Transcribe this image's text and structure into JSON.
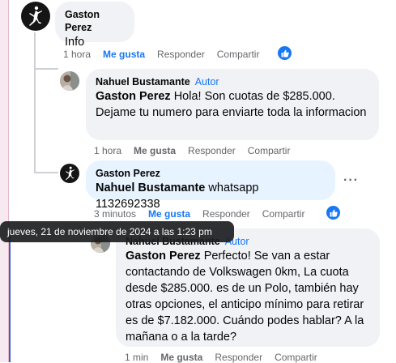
{
  "comments": [
    {
      "author": "Gaston Perez",
      "text": "Info",
      "time": "1 hora",
      "like": "Me gusta",
      "reply": "Responder",
      "share": "Compartir"
    },
    {
      "author": "Nahuel Bustamante",
      "badge": "Autor",
      "mention": "Gaston Perez",
      "text": " Hola! Son cuotas de $285.000. Dejame tu numero para enviarte toda la informacion",
      "time": "1 hora",
      "like": "Me gusta",
      "reply": "Responder",
      "share": "Compartir"
    },
    {
      "author": "Gaston Perez",
      "mention": "Nahuel Bustamante",
      "text": " whatsapp 1132692338",
      "time": "3 minutos",
      "like": "Me gusta",
      "reply": "Responder",
      "share": "Compartir",
      "more": "···"
    },
    {
      "author": "Nahuel Bustamante",
      "badge": "Autor",
      "mention": "Gaston Perez",
      "text": " Perfecto! Se van a estar contactando de Volkswagen 0km, La cuota desde $285.000. es de un Polo, también hay otras opciones, el anticipo mínimo para retirar es de $7.182.000. Cuándo podes hablar? A la mañana o a la tarde?",
      "time": "1 min",
      "like": "Me gusta",
      "reply": "Responder",
      "share": "Compartir"
    }
  ],
  "tooltip": "jueves, 21 de noviembre de 2024 a las 1:23 pm",
  "colors": {
    "accent": "#1877f2",
    "bubble": "#f0f2f5",
    "meta": "#65676b"
  },
  "icons": [
    "jordan-logo-icon",
    "thumbs-up-icon",
    "more-options-icon"
  ]
}
